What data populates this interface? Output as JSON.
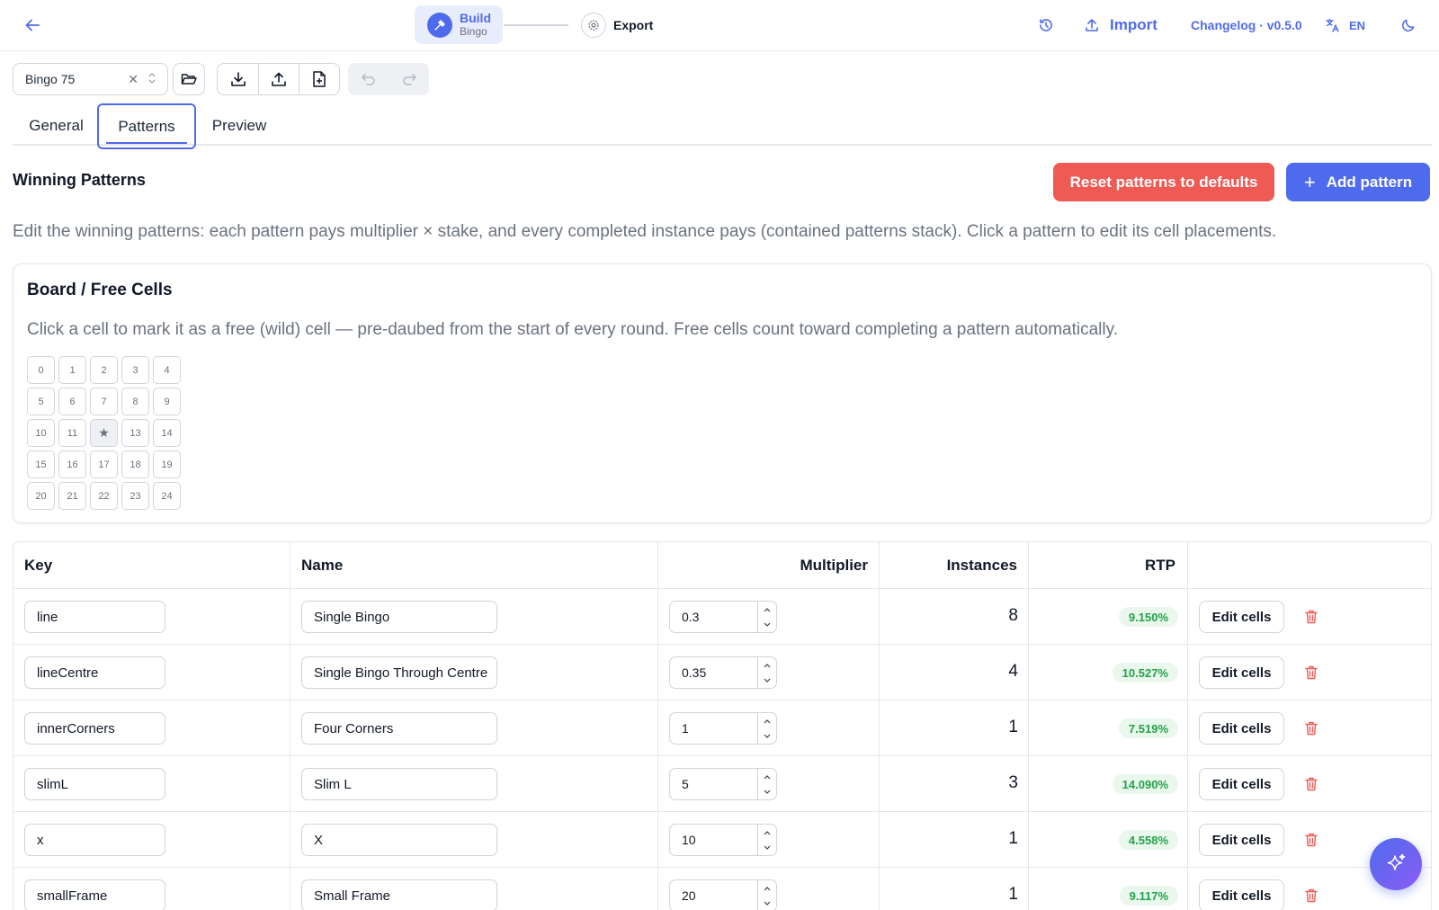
{
  "header": {
    "steps": [
      {
        "title": "Build",
        "subtitle": "Bingo"
      },
      {
        "title": "Export"
      }
    ],
    "import_label": "Import",
    "changelog_label": "Changelog · v0.5.0",
    "language": "EN"
  },
  "toolbar": {
    "game_select_value": "Bingo 75"
  },
  "tabs": [
    {
      "label": "General",
      "active": false
    },
    {
      "label": "Patterns",
      "active": true
    },
    {
      "label": "Preview",
      "active": false
    }
  ],
  "patterns_section": {
    "title": "Winning Patterns",
    "reset_label": "Reset patterns to defaults",
    "add_label": "Add pattern",
    "description": "Edit the winning patterns: each pattern pays multiplier × stake, and every completed instance pays (contained patterns stack). Click a pattern to edit its cell placements."
  },
  "board": {
    "title": "Board / Free Cells",
    "description": "Click a cell to mark it as a free (wild) cell — pre-daubed from the start of every round. Free cells count toward completing a pattern automatically.",
    "cells": [
      "0",
      "1",
      "2",
      "3",
      "4",
      "5",
      "6",
      "7",
      "8",
      "9",
      "10",
      "11",
      "★",
      "13",
      "14",
      "15",
      "16",
      "17",
      "18",
      "19",
      "20",
      "21",
      "22",
      "23",
      "24"
    ],
    "free_cells": [
      12
    ]
  },
  "table": {
    "headers": {
      "key": "Key",
      "name": "Name",
      "multiplier": "Multiplier",
      "instances": "Instances",
      "rtp": "RTP"
    },
    "edit_label": "Edit cells",
    "rows": [
      {
        "key": "line",
        "name": "Single Bingo",
        "multiplier": "0.3",
        "instances": "8",
        "rtp": "9.150%"
      },
      {
        "key": "lineCentre",
        "name": "Single Bingo Through Centre",
        "multiplier": "0.35",
        "instances": "4",
        "rtp": "10.527%"
      },
      {
        "key": "innerCorners",
        "name": "Four Corners",
        "multiplier": "1",
        "instances": "1",
        "rtp": "7.519%"
      },
      {
        "key": "slimL",
        "name": "Slim L",
        "multiplier": "5",
        "instances": "3",
        "rtp": "14.090%"
      },
      {
        "key": "x",
        "name": "X",
        "multiplier": "10",
        "instances": "1",
        "rtp": "4.558%"
      },
      {
        "key": "smallFrame",
        "name": "Small Frame",
        "multiplier": "20",
        "instances": "1",
        "rtp": "9.117%"
      }
    ]
  },
  "colors": {
    "accent": "#4f6bed",
    "danger": "#ef5a55",
    "success": "#22a34a"
  }
}
